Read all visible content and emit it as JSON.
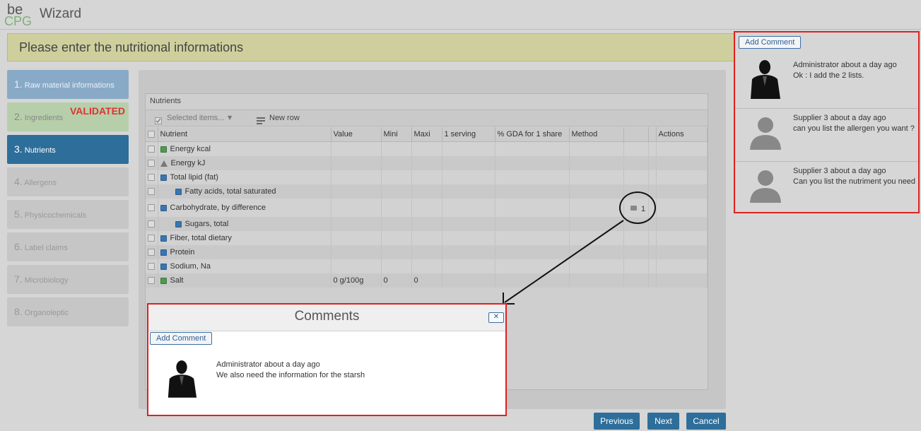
{
  "app": {
    "logo_top": "be",
    "logo_bottom": "CPG",
    "title": "Wizard"
  },
  "banner": {
    "text": "Please enter the nutritional informations"
  },
  "steps": [
    {
      "num": "1.",
      "label": "Raw material informations",
      "state": "done"
    },
    {
      "num": "2.",
      "label": "Ingredients",
      "state": "validated"
    },
    {
      "num": "3.",
      "label": "Nutrients",
      "state": "active"
    },
    {
      "num": "4.",
      "label": "Allergens",
      "state": "todo"
    },
    {
      "num": "5.",
      "label": "Physicochemicals",
      "state": "todo"
    },
    {
      "num": "6.",
      "label": "Label claims",
      "state": "todo"
    },
    {
      "num": "7.",
      "label": "Microbiology",
      "state": "todo"
    },
    {
      "num": "8.",
      "label": "Organoleptic",
      "state": "todo"
    }
  ],
  "validated_label": "VALIDATED",
  "grid": {
    "title": "Nutrients",
    "toolbar": {
      "selected_items": "Selected items...",
      "new_row": "New row"
    },
    "columns": [
      "Nutrient",
      "Value",
      "Mini",
      "Maxi",
      "1 serving",
      "% GDA for 1 share",
      "Method",
      "",
      "",
      "Actions"
    ],
    "rows": [
      {
        "name": "Energy kcal",
        "icon": "green",
        "indent": false,
        "value": "",
        "mini": "",
        "maxi": ""
      },
      {
        "name": "Energy kJ",
        "icon": "warn",
        "indent": false,
        "value": "",
        "mini": "",
        "maxi": ""
      },
      {
        "name": "Total lipid (fat)",
        "icon": "blue",
        "indent": false,
        "value": "",
        "mini": "",
        "maxi": ""
      },
      {
        "name": "Fatty acids, total saturated",
        "icon": "blue",
        "indent": true,
        "value": "",
        "mini": "",
        "maxi": ""
      },
      {
        "name": "Carbohydrate, by difference",
        "icon": "blue",
        "indent": false,
        "value": "",
        "mini": "",
        "maxi": "",
        "comment_count": "1"
      },
      {
        "name": "Sugars, total",
        "icon": "blue",
        "indent": true,
        "value": "",
        "mini": "",
        "maxi": ""
      },
      {
        "name": "Fiber, total dietary",
        "icon": "blue",
        "indent": false,
        "value": "",
        "mini": "",
        "maxi": ""
      },
      {
        "name": "Protein",
        "icon": "blue",
        "indent": false,
        "value": "",
        "mini": "",
        "maxi": ""
      },
      {
        "name": "Sodium, Na",
        "icon": "blue",
        "indent": false,
        "value": "",
        "mini": "",
        "maxi": ""
      },
      {
        "name": "Salt",
        "icon": "green",
        "indent": false,
        "value": "0 g/100g",
        "mini": "0",
        "maxi": "0"
      }
    ]
  },
  "side_panel": {
    "add_label": "Add Comment",
    "comments": [
      {
        "author": "Administrator about a day ago",
        "text": "Ok : I add the 2 lists.",
        "avatar": "admin"
      },
      {
        "author": "Supplier 3 about a day ago",
        "text": "can you list the allergen you want ?",
        "avatar": "generic"
      },
      {
        "author": "Supplier 3 about a day ago",
        "text": "Can you list the nutriment you need",
        "avatar": "generic"
      }
    ]
  },
  "modal": {
    "title": "Comments",
    "close_label": "✕",
    "add_label": "Add Comment",
    "comment": {
      "author": "Administrator about a day ago",
      "text": "We also need the information for the starsh"
    }
  },
  "footer": {
    "previous": "Previous",
    "next": "Next",
    "cancel": "Cancel"
  },
  "colors": {
    "accent": "#2e6e9a",
    "highlight_border": "#e02020",
    "validated": "#dd3333"
  }
}
